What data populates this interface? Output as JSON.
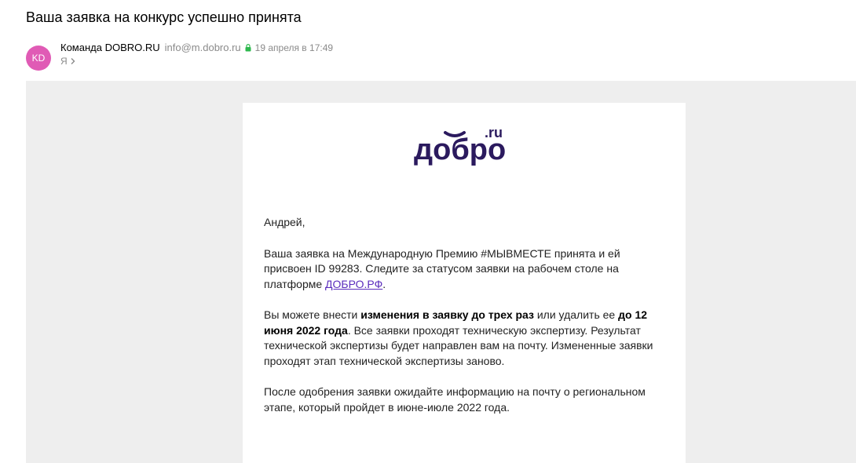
{
  "email": {
    "subject": "Ваша заявка на конкурс успешно принята",
    "avatar_initials": "KD",
    "sender_name": "Команда DOBRO.RU",
    "sender_email": "info@m.dobro.ru",
    "date": "19 апреля в 17:49",
    "recipient": "Я",
    "icons": [
      "lock-icon",
      "chevron-right-icon"
    ]
  },
  "message": {
    "logo_text": "добро",
    "logo_suffix": ".ru",
    "greeting": "Андрей,",
    "p1_text": "Ваша заявка на Международную Премию #МЫВМЕСТЕ принята и ей присвоен ID 99283. Следите за статусом заявки на рабочем столе на платформе ",
    "p1_link": "ДОБРО.РФ",
    "p1_end": ".",
    "p2_a": "Вы можете внести ",
    "p2_bold1": "изменения в заявку до трех раз",
    "p2_b": " или удалить ее ",
    "p2_bold2": "до 12 июня 2022 года",
    "p2_c": ". Все заявки проходят техническую экспертизу. Результат технической экспертизы будет направлен вам на почту. Измененные заявки проходят этап технической экспертизы заново.",
    "p3_text": "После одобрения заявки ожидайте информацию на почту о региональном этапе, который пройдет в июне-июле 2022 года."
  },
  "colors": {
    "avatar": "#e05bb5",
    "brand": "#2b1a5e",
    "link": "#5b2dbd",
    "lock": "#2db84d"
  }
}
